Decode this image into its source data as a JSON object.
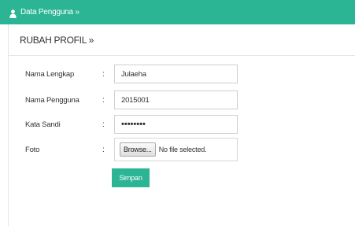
{
  "topbar": {
    "icon": "person-icon",
    "title": "Data Pengguna »",
    "color": "#2bb594"
  },
  "panel": {
    "title": "RUBAH PROFIL »"
  },
  "form": {
    "full_name": {
      "label": "Nama Lengkap",
      "colon": ":",
      "value": "Julaeha"
    },
    "username": {
      "label": "Nama Pengguna",
      "colon": ":",
      "value": "2015001"
    },
    "password": {
      "label": "Kata Sandi",
      "colon": ":",
      "value": "••••••••"
    },
    "photo": {
      "label": "Foto",
      "colon": ":",
      "browse_label": "Browse...",
      "status": "No file selected."
    },
    "save_label": "Simpan"
  }
}
